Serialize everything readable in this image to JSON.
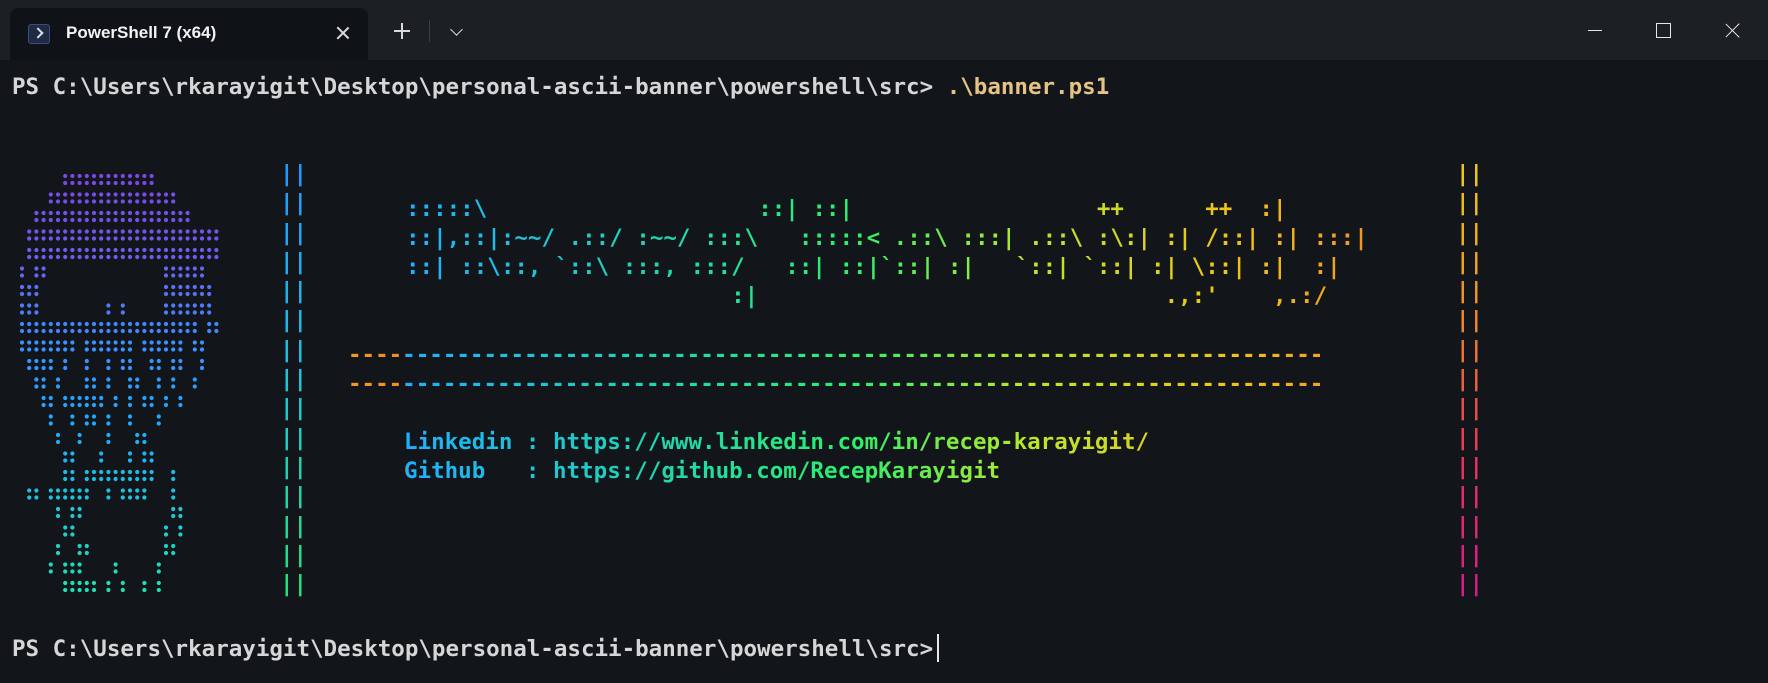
{
  "window": {
    "tab_title": "PowerShell 7 (x64)",
    "icons": [
      "powershell-icon",
      "close-tab-icon",
      "plus-icon",
      "chevron-down-icon",
      "minimize-icon",
      "maximize-icon",
      "close-icon"
    ]
  },
  "terminal": {
    "prompt": "PS C:\\Users\\rkarayigit\\Desktop\\personal-ascii-banner\\powershell\\src>",
    "command": ".\\banner.ps1",
    "bar": "||",
    "bar_count": 15,
    "art_lines": [
      ":::::\\                    ::| ::|                  ++      ++  :|",
      "::|,::|:~~/ .::/ :~~/ :::\\   :::::< .::\\ :::| .::\\ :\\:| :| /::| :| :::|",
      "::| ::\\::, `::\\ :::, :::/   ::| ::|`::| :|   `::| `::| :| \\::| :|  :|",
      "                        :|                              .,:'    ,.:/"
    ],
    "separator": "------------------------------------------------------------------------",
    "links": [
      {
        "label": "Linkedin : ",
        "url": "https://www.linkedin.com/in/recep-karayigit/"
      },
      {
        "label": "Github   : ",
        "url": "https://github.com/RecepKarayigit"
      }
    ],
    "colors": {
      "prompt": "#d6d6d6",
      "command": "#e6c385",
      "gradient": [
        "#1fb0ff",
        "#1fd6b0",
        "#2ef06a",
        "#b7e82c",
        "#f0c419",
        "#f08a24",
        "#e8365a",
        "#d81b8a"
      ]
    }
  }
}
